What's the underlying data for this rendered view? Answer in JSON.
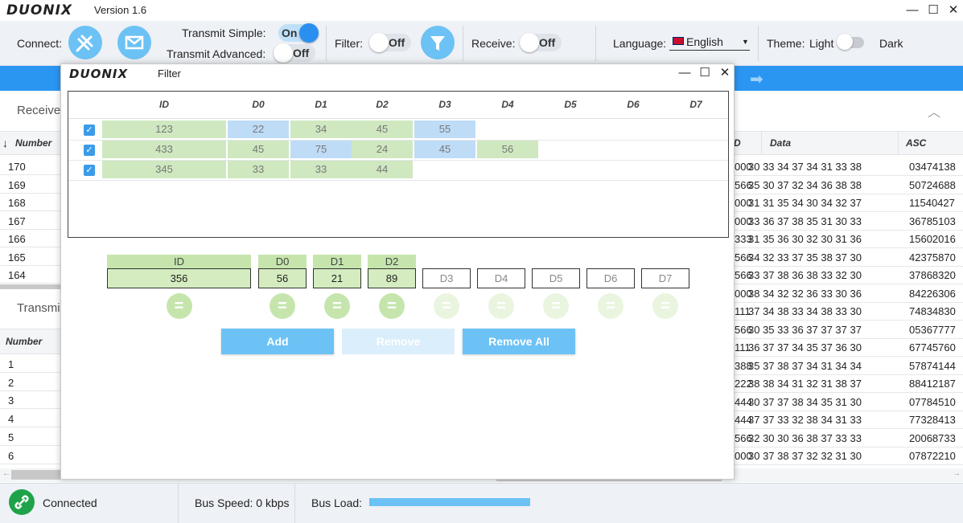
{
  "app": {
    "logo": "DUONIX",
    "version": "Version 1.6"
  },
  "window_controls": {
    "minimize": "—",
    "maximize": "☐",
    "close": "✕"
  },
  "toolbar": {
    "connect_label": "Connect:",
    "transmit_simple_label": "Transmit Simple:",
    "transmit_simple_state": "On",
    "transmit_advanced_label": "Transmit Advanced:",
    "transmit_advanced_state": "Off",
    "filter_label": "Filter:",
    "filter_state": "Off",
    "receive_label": "Receive:",
    "receive_state": "Off",
    "language_label": "Language:",
    "language_value": "English",
    "theme_label": "Theme:",
    "theme_light": "Light",
    "theme_dark": "Dark"
  },
  "receive_panel": {
    "title": "Receive:",
    "number_header": "Number",
    "numbers": [
      "170",
      "169",
      "168",
      "167",
      "166",
      "165",
      "164"
    ],
    "data_header": "Data",
    "asc_header": "ASC",
    "id_header": "D",
    "rows": [
      {
        "id": "000",
        "data": "30 33 34 37 34 31 33 38",
        "asc": "03474138"
      },
      {
        "id": "566",
        "data": "35 30 37 32 34 36 38 38",
        "asc": "50724688"
      },
      {
        "id": "000",
        "data": "31 31 35 34 30 34 32 37",
        "asc": "11540427"
      },
      {
        "id": "000",
        "data": "33 36 37 38 35 31 30 33",
        "asc": "36785103"
      },
      {
        "id": "333",
        "data": "31 35 36 30 32 30 31 36",
        "asc": "15602016"
      },
      {
        "id": "566",
        "data": "34 32 33 37 35 38 37 30",
        "asc": "42375870"
      },
      {
        "id": "566",
        "data": "33 37 38 36 38 33 32 30",
        "asc": "37868320"
      },
      {
        "id": "000",
        "data": "38 34 32 32 36 33 30 36",
        "asc": "84226306"
      },
      {
        "id": "111",
        "data": "37 34 38 33 34 38 33 30",
        "asc": "74834830"
      },
      {
        "id": "566",
        "data": "30 35 33 36 37 37 37 37",
        "asc": "05367777"
      },
      {
        "id": "111",
        "data": "36 37 37 34 35 37 36 30",
        "asc": "67745760"
      },
      {
        "id": "388",
        "data": "35 37 38 37 34 31 34 34",
        "asc": "57874144"
      },
      {
        "id": "222",
        "data": "38 38 34 31 32 31 38 37",
        "asc": "88412187"
      },
      {
        "id": "444",
        "data": "30 37 37 38 34 35 31 30",
        "asc": "07784510"
      },
      {
        "id": "444",
        "data": "37 37 33 32 38 34 31 33",
        "asc": "77328413"
      },
      {
        "id": "566",
        "data": "32 30 30 36 38 37 33 33",
        "asc": "20068733"
      },
      {
        "id": "000",
        "data": "30 37 38 37 32 32 31 30",
        "asc": "07872210"
      }
    ]
  },
  "transmit_panel": {
    "title": "Transmi",
    "number_header": "Number",
    "numbers": [
      "1",
      "2",
      "3",
      "4",
      "5",
      "6"
    ]
  },
  "filter_dialog": {
    "logo": "DUONIX",
    "title": "Filter",
    "columns": [
      "ID",
      "D0",
      "D1",
      "D2",
      "D3",
      "D4",
      "D5",
      "D6",
      "D7"
    ],
    "rows": [
      {
        "checked": true,
        "cells": [
          "123",
          "22",
          "34",
          "45",
          "55"
        ],
        "colors": [
          "green",
          "blue",
          "green",
          "green",
          "blue"
        ]
      },
      {
        "checked": true,
        "cells": [
          "433",
          "45",
          "75",
          "24",
          "45",
          "56"
        ],
        "colors": [
          "green",
          "green",
          "blue",
          "green",
          "blue",
          "green"
        ]
      },
      {
        "checked": true,
        "cells": [
          "345",
          "33",
          "33",
          "44"
        ],
        "colors": [
          "green",
          "green",
          "green",
          "green"
        ]
      }
    ],
    "editor": {
      "labels": [
        "ID",
        "D0",
        "D1",
        "D2"
      ],
      "values": [
        "356",
        "56",
        "21",
        "89"
      ],
      "placeholders": [
        "D3",
        "D4",
        "D5",
        "D6",
        "D7"
      ],
      "eq_symbol": "="
    },
    "buttons": {
      "add": "Add",
      "remove": "Remove",
      "remove_all": "Remove All"
    }
  },
  "status": {
    "connection": "Connected",
    "bus_speed": "Bus Speed: 0 kbps",
    "bus_load_label": "Bus Load:",
    "bus_load_fraction": 1.0
  },
  "colors": {
    "accent": "#2b96f2",
    "button": "#6cc2f5",
    "green_cell": "#cfe8c0",
    "blue_cell": "#bfdcf7",
    "status_ok": "#1fa34a"
  }
}
